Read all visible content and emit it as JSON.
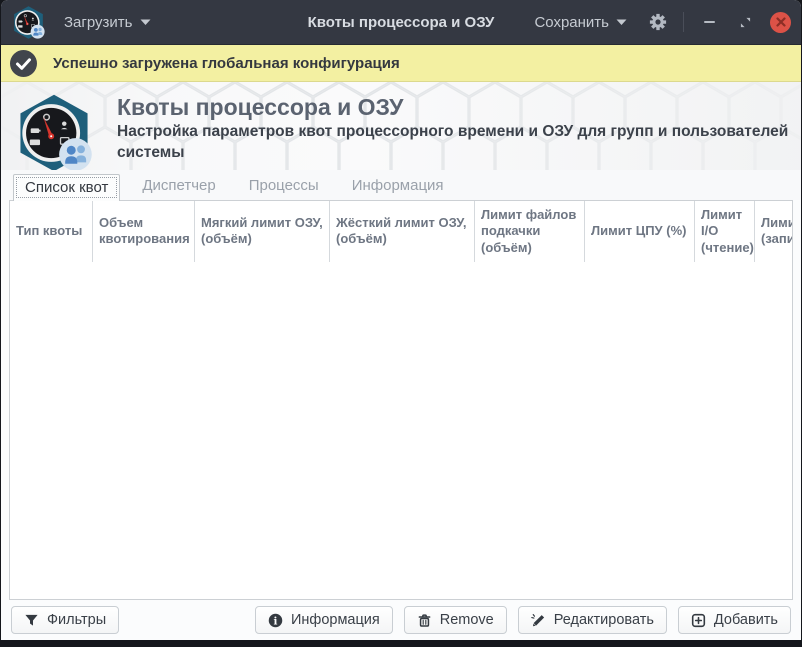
{
  "titlebar": {
    "app_title": "Квоты процессора и ОЗУ",
    "load_label": "Загрузить",
    "save_label": "Сохранить"
  },
  "infobar": {
    "message": "Успешно загружена глобальная конфигурация"
  },
  "hero": {
    "title": "Квоты процессора и ОЗУ",
    "subtitle": "Настройка параметров квот процессорного времени и ОЗУ для групп и пользователей системы"
  },
  "tabs": [
    {
      "label": "Список квот",
      "active": true
    },
    {
      "label": "Диспетчер",
      "active": false
    },
    {
      "label": "Процессы",
      "active": false
    },
    {
      "label": "Информация",
      "active": false
    }
  ],
  "table": {
    "columns": [
      "Тип квоты",
      "Объем квотирования",
      "Мягкий лимит ОЗУ, (объём)",
      "Жёсткий лимит ОЗУ, (объём)",
      "Лимит файлов подкачки (объём)",
      "Лимит ЦПУ (%)",
      "Лимит I/O (чтение)",
      "Лимит I/O (запись)"
    ],
    "rows": []
  },
  "actionbar": {
    "filters_label": "Фильтры",
    "info_label": "Информация",
    "remove_label": "Remove",
    "edit_label": "Редактировать",
    "add_label": "Добавить"
  },
  "icons": {
    "app": "gauge-hexagon-with-users-badge",
    "banner": "check-circle",
    "filters": "filter-funnel",
    "info": "info-circle",
    "remove": "trash",
    "edit": "pencil-sparkle",
    "add": "plus-square",
    "settings": "gear",
    "window": [
      "minimize-dash",
      "restore-triangles",
      "close-x-circle"
    ],
    "dropdown": "caret-down"
  },
  "colors": {
    "headerbar_bg": "#343842",
    "infobar_bg": "#f3f0a2",
    "close_button": "#dc5247",
    "hero_bg": "#f0f1f2",
    "app_hexagon": "#1e5f7b",
    "badge_blue": "#4f86c6",
    "header_text": "#6e7683"
  }
}
